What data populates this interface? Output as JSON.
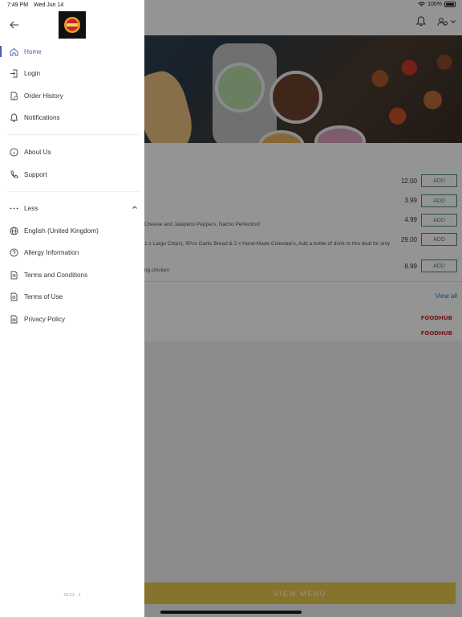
{
  "status_bar": {
    "time": "7:49 PM",
    "date": "Wed Jun 14",
    "battery": "100%"
  },
  "drawer": {
    "primary": [
      {
        "label": "Home",
        "icon": "home-icon",
        "active": true
      },
      {
        "label": "Login",
        "icon": "login-icon"
      },
      {
        "label": "Order History",
        "icon": "order-history-icon"
      },
      {
        "label": "Notifications",
        "icon": "bell-icon"
      }
    ],
    "secondary": [
      {
        "label": "About Us",
        "icon": "info-icon"
      },
      {
        "label": "Support",
        "icon": "phone-icon"
      }
    ],
    "more": {
      "label": "Less",
      "icon": "more-dots-icon"
    },
    "extra": [
      {
        "label": "English (United Kingdom)",
        "icon": "globe-icon"
      },
      {
        "label": "Allergy Information",
        "icon": "help-circle-icon"
      },
      {
        "label": "Terms and Conditions",
        "icon": "document-icon"
      },
      {
        "label": "Terms of Use",
        "icon": "document-search-icon"
      },
      {
        "label": "Privacy Policy",
        "icon": "privacy-icon"
      }
    ],
    "version": "10.11 - 1"
  },
  "menu": {
    "items": [
      {
        "description": "",
        "price": "12.00",
        "action": "ADD"
      },
      {
        "description": "",
        "price": "3.99",
        "action": "ADD"
      },
      {
        "description": "Cheese and Jalapeno Peppers, Nacho Perfection!",
        "price": "4.99",
        "action": "ADD"
      },
      {
        "description": "1 x Large Chips), 6Pcs Garlic Bread & 2 x Hand-Made Coleslaw's, Add a bottle of drink to this deal for only",
        "price": "29.00",
        "action": "ADD"
      },
      {
        "description": "ng chicken",
        "price": "8.99",
        "action": "ADD"
      }
    ],
    "view_all": "View all",
    "brands": [
      "FOODHUB",
      "FOODHUB"
    ],
    "view_menu": "VIEW MENU"
  },
  "colors": {
    "accent": "#4d5fb0",
    "add_button": "#4a8a70",
    "view_menu": "#e6c94a",
    "brand": "#c8262a"
  }
}
